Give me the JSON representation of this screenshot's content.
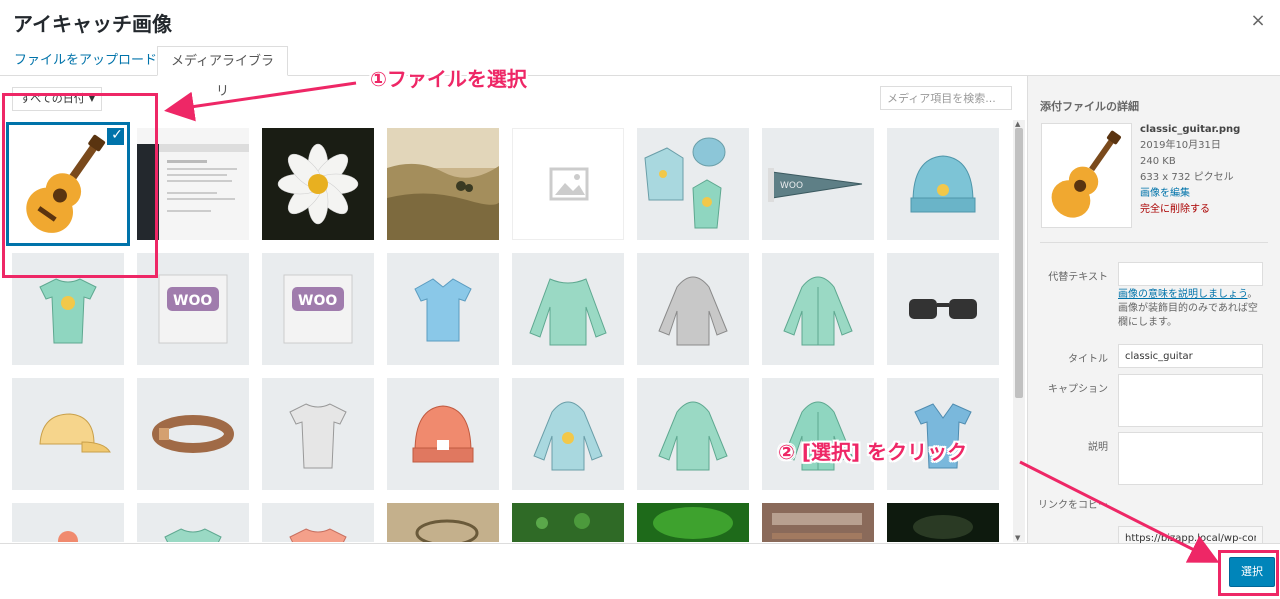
{
  "modal": {
    "title": "アイキャッチ画像",
    "close": "×"
  },
  "tabs": {
    "upload": "ファイルをアップロード",
    "library": "メディアライブラリ"
  },
  "toolbar": {
    "date_filter": "すべての日付",
    "date_arrow": "▼",
    "search_placeholder": "メディア項目を検索..."
  },
  "items": [
    {
      "name": "classic_guitar",
      "selected": true
    },
    {
      "name": "screenshot"
    },
    {
      "name": "white-flower"
    },
    {
      "name": "landscape"
    },
    {
      "name": "placeholder"
    },
    {
      "name": "hoodie-set"
    },
    {
      "name": "pennant"
    },
    {
      "name": "beanie-blue"
    },
    {
      "name": "tshirt-green-logo"
    },
    {
      "name": "woo-single"
    },
    {
      "name": "woo-album"
    },
    {
      "name": "polo-blue"
    },
    {
      "name": "longsleeve-green"
    },
    {
      "name": "hoodie-gray"
    },
    {
      "name": "hoodie-zip-green"
    },
    {
      "name": "sunglasses"
    },
    {
      "name": "cap-yellow"
    },
    {
      "name": "belt"
    },
    {
      "name": "tshirt-gray"
    },
    {
      "name": "beanie-orange"
    },
    {
      "name": "hoodie-blue-logo"
    },
    {
      "name": "hoodie-green"
    },
    {
      "name": "hoodie-zip-green-2"
    },
    {
      "name": "vneck-blue"
    },
    {
      "name": "row4-1"
    },
    {
      "name": "row4-2"
    },
    {
      "name": "row4-3"
    },
    {
      "name": "row4-4"
    },
    {
      "name": "row4-5"
    },
    {
      "name": "row4-6"
    },
    {
      "name": "row4-7"
    },
    {
      "name": "row4-8"
    }
  ],
  "details": {
    "heading": "添付ファイルの詳細",
    "filename": "classic_guitar.png",
    "date": "2019年10月31日",
    "size": "240 KB",
    "dimensions": "633 x 732 ピクセル",
    "edit": "画像を編集",
    "delete": "完全に削除する"
  },
  "fields": {
    "alt_label": "代替テキスト",
    "alt_help_link": "画像の意味を説明しましょう",
    "alt_help_text": "。画像が装飾目的のみであれば空欄にします。",
    "title_label": "タイトル",
    "title_value": "classic_guitar",
    "caption_label": "キャプション",
    "description_label": "説明",
    "link_label": "リンクをコピー",
    "link_value": "https://bizapp.local/wp-con"
  },
  "footer": {
    "select_button": "選択"
  },
  "annotations": {
    "step1": "①ファイルを選択",
    "step2": "② [選択] をクリック"
  },
  "colors": {
    "accent": "#0073aa",
    "button": "#0085ba",
    "annotation": "#ee2766"
  }
}
